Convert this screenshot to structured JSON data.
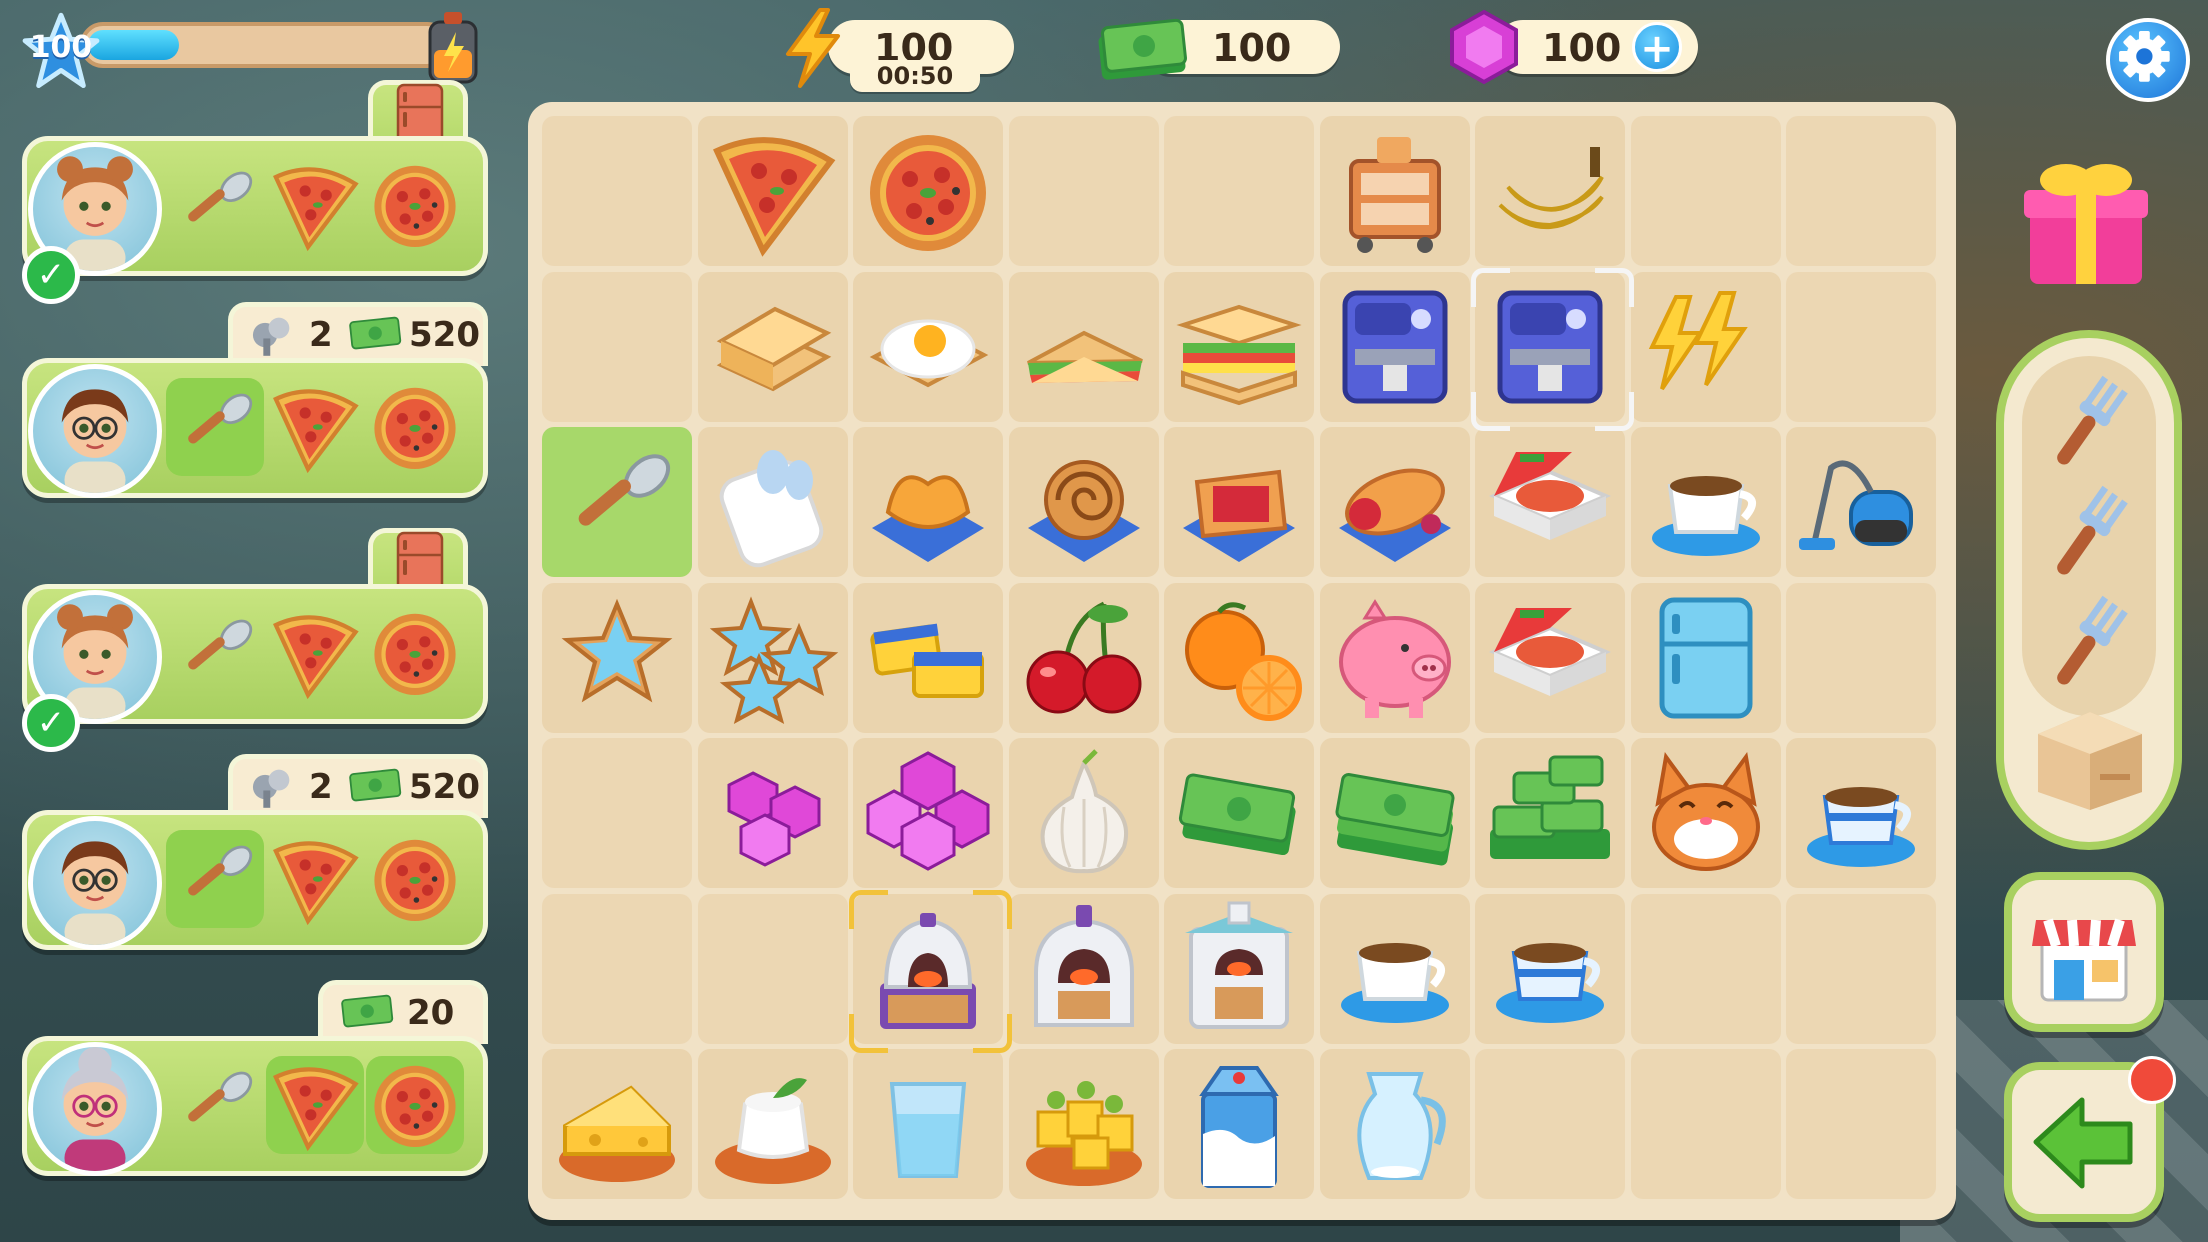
{
  "hud": {
    "level": "100",
    "energy": {
      "value": "100",
      "timer": "00:50"
    },
    "cash": {
      "value": "100"
    },
    "gems": {
      "value": "100",
      "add_label": "+"
    },
    "xp_progress": 0.25
  },
  "orders": [
    {
      "character": "woman-bun-hair",
      "completed": true,
      "tab": "fridge-icon",
      "items": [
        "spoon",
        "pizza-slice",
        "pizza"
      ]
    },
    {
      "character": "woman-glasses",
      "completed": false,
      "reward_tools": "2",
      "reward_cash": "520",
      "items": [
        "spoon",
        "pizza-slice",
        "pizza"
      ]
    },
    {
      "character": "woman-bun-hair",
      "completed": true,
      "tab": "fridge-icon",
      "items": [
        "spoon",
        "pizza-slice",
        "pizza"
      ]
    },
    {
      "character": "woman-glasses",
      "completed": false,
      "reward_tools": "2",
      "reward_cash": "520",
      "items": [
        "spoon",
        "pizza-slice",
        "pizza"
      ]
    },
    {
      "character": "grandma",
      "completed": false,
      "reward_cash": "20",
      "items": [
        "spoon",
        "pizza-slice",
        "pizza"
      ]
    }
  ],
  "board": [
    [
      "",
      "pizza-slice",
      "pizza",
      "",
      "",
      "kitchen-cart",
      "bananas",
      "",
      ""
    ],
    [
      "",
      "toast",
      "fried-egg",
      "sandwich-half",
      "sandwich",
      "coffee-machine",
      "coffee-machine",
      "energy-bolts",
      ""
    ],
    [
      "spoon",
      "cutlery-napkin",
      "palmier",
      "cinnamon-roll",
      "berry-tart",
      "strudel",
      "pizza-box",
      "coffee-cup",
      "vacuum"
    ],
    [
      "star-cookie",
      "star-cookies",
      "sponges",
      "cherries",
      "oranges",
      "piggy-bank",
      "pizza-box",
      "fridge",
      ""
    ],
    [
      "",
      "gems-small",
      "gems-large",
      "garlic",
      "cash-small",
      "cash-stack",
      "cash-pile",
      "cat",
      "coffee-blue-cup"
    ],
    [
      "",
      "",
      "oven-small",
      "oven-medium",
      "oven-large",
      "coffee-cup",
      "coffee-blue-cup",
      "",
      ""
    ],
    [
      "cheese",
      "panna-cotta",
      "glass-water",
      "cheese-canapes",
      "milk-carton",
      "water-jug",
      "",
      "",
      ""
    ]
  ],
  "side_panel": {
    "queue": [
      "fork-icon",
      "fork-icon",
      "fork-icon"
    ],
    "storage": "box-icon",
    "shop": "shop-icon",
    "back": "back-arrow-icon",
    "gift": "gift-icon"
  },
  "colors": {
    "board": "#f1e2c6",
    "order_green": "#b6da6c",
    "accent_blue": "#1d8fe0"
  }
}
